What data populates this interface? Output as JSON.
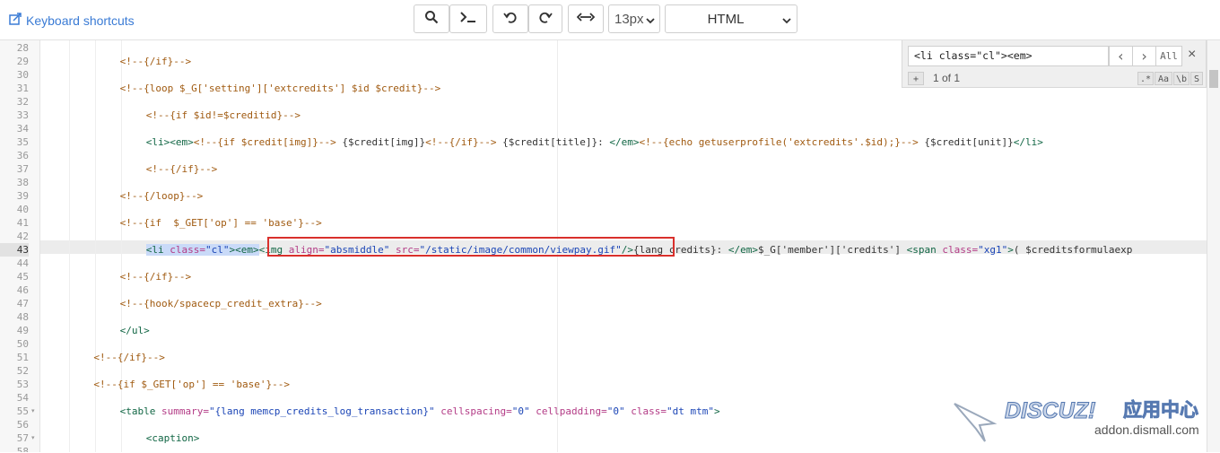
{
  "toolbar": {
    "keyboard_shortcuts": "Keyboard shortcuts",
    "font_size": "13px",
    "language": "HTML",
    "icons": [
      "search-icon",
      "terminal-icon",
      "undo-icon",
      "redo-icon",
      "wrap-toggle-icon"
    ]
  },
  "find": {
    "query": "<li class=\"cl\"><em>",
    "next_prev": [
      "‹",
      "›"
    ],
    "all_label": "All",
    "close_label": "×",
    "replace_toggle": "+",
    "count": "1 of 1",
    "options": [
      ".*",
      "Aa",
      "\\b",
      "S"
    ]
  },
  "colors": {
    "comment": "#a05a10",
    "tag": "#116644",
    "attribute": "#b33b86",
    "string": "#1b45b6",
    "highlight": "#c9daf8",
    "red_box": "#d9302c",
    "link": "#3a7bd5"
  },
  "editor": {
    "active_line": "43",
    "lines": [
      {
        "no": "28",
        "fold": "",
        "indent": 0,
        "tokens": []
      },
      {
        "no": "29",
        "fold": "",
        "indent": 3,
        "tokens": [
          {
            "c": "c",
            "t": "<!--{/if}-->"
          }
        ]
      },
      {
        "no": "30",
        "fold": "",
        "indent": 0,
        "tokens": []
      },
      {
        "no": "31",
        "fold": "",
        "indent": 3,
        "tokens": [
          {
            "c": "c",
            "t": "<!--{loop $_G['setting']['extcredits'] $id $credit}-->"
          }
        ]
      },
      {
        "no": "32",
        "fold": "",
        "indent": 0,
        "tokens": []
      },
      {
        "no": "33",
        "fold": "",
        "indent": 4,
        "tokens": [
          {
            "c": "c",
            "t": "<!--{if $id!=$creditid}-->"
          }
        ]
      },
      {
        "no": "34",
        "fold": "",
        "indent": 0,
        "tokens": []
      },
      {
        "no": "35",
        "fold": "",
        "indent": 4,
        "tokens": [
          {
            "c": "t",
            "t": "<li><em>"
          },
          {
            "c": "c",
            "t": "<!--{if $credit[img]}-->"
          },
          {
            "c": "p",
            "t": " {$credit[img]}"
          },
          {
            "c": "c",
            "t": "<!--{/if}-->"
          },
          {
            "c": "p",
            "t": " {$credit[title]}: "
          },
          {
            "c": "t",
            "t": "</em>"
          },
          {
            "c": "c",
            "t": "<!--{echo getuserprofile('extcredits'.$id);}-->"
          },
          {
            "c": "p",
            "t": " {$credit[unit]}"
          },
          {
            "c": "t",
            "t": "</li>"
          }
        ]
      },
      {
        "no": "36",
        "fold": "",
        "indent": 0,
        "tokens": []
      },
      {
        "no": "37",
        "fold": "",
        "indent": 4,
        "tokens": [
          {
            "c": "c",
            "t": "<!--{/if}-->"
          }
        ]
      },
      {
        "no": "38",
        "fold": "",
        "indent": 0,
        "tokens": []
      },
      {
        "no": "39",
        "fold": "",
        "indent": 3,
        "tokens": [
          {
            "c": "c",
            "t": "<!--{/loop}-->"
          }
        ]
      },
      {
        "no": "40",
        "fold": "",
        "indent": 0,
        "tokens": []
      },
      {
        "no": "41",
        "fold": "",
        "indent": 3,
        "tokens": [
          {
            "c": "c",
            "t": "<!--{if  $_GET['op'] == 'base'}-->"
          }
        ]
      },
      {
        "no": "42",
        "fold": "",
        "indent": 0,
        "tokens": []
      },
      {
        "no": "43",
        "fold": "",
        "indent": 4,
        "tokens": [
          {
            "c": "t",
            "t": "<li",
            "h": 1
          },
          {
            "c": "p",
            "t": " ",
            "h": 1
          },
          {
            "c": "a",
            "t": "class=",
            "h": 1
          },
          {
            "c": "s",
            "t": "\"cl\"",
            "h": 1
          },
          {
            "c": "t",
            "t": "><em>",
            "h": 1
          },
          {
            "c": "t",
            "t": "<img"
          },
          {
            "c": "p",
            "t": " "
          },
          {
            "c": "a",
            "t": "align="
          },
          {
            "c": "s",
            "t": "\"absmiddle\""
          },
          {
            "c": "p",
            "t": " "
          },
          {
            "c": "a",
            "t": "src="
          },
          {
            "c": "s",
            "t": "\"/static/image/common/viewpay.gif\""
          },
          {
            "c": "t",
            "t": "/>"
          },
          {
            "c": "p",
            "t": "{lang credits}: "
          },
          {
            "c": "t",
            "t": "</em>"
          },
          {
            "c": "p",
            "t": "$_G['member']['credits'] "
          },
          {
            "c": "t",
            "t": "<span"
          },
          {
            "c": "p",
            "t": " "
          },
          {
            "c": "a",
            "t": "class="
          },
          {
            "c": "s",
            "t": "\"xg1\""
          },
          {
            "c": "t",
            "t": ">"
          },
          {
            "c": "p",
            "t": "( $creditsformulaexp"
          }
        ]
      },
      {
        "no": "44",
        "fold": "",
        "indent": 0,
        "tokens": []
      },
      {
        "no": "45",
        "fold": "",
        "indent": 3,
        "tokens": [
          {
            "c": "c",
            "t": "<!--{/if}-->"
          }
        ]
      },
      {
        "no": "46",
        "fold": "",
        "indent": 0,
        "tokens": []
      },
      {
        "no": "47",
        "fold": "",
        "indent": 3,
        "tokens": [
          {
            "c": "c",
            "t": "<!--{hook/spacecp_credit_extra}-->"
          }
        ]
      },
      {
        "no": "48",
        "fold": "",
        "indent": 0,
        "tokens": []
      },
      {
        "no": "49",
        "fold": "",
        "indent": 3,
        "tokens": [
          {
            "c": "t",
            "t": "</ul>"
          }
        ]
      },
      {
        "no": "50",
        "fold": "",
        "indent": 0,
        "tokens": []
      },
      {
        "no": "51",
        "fold": "",
        "indent": 2,
        "tokens": [
          {
            "c": "c",
            "t": "<!--{/if}-->"
          }
        ]
      },
      {
        "no": "52",
        "fold": "",
        "indent": 0,
        "tokens": []
      },
      {
        "no": "53",
        "fold": "",
        "indent": 2,
        "tokens": [
          {
            "c": "c",
            "t": "<!--{if $_GET['op'] == 'base'}-->"
          }
        ]
      },
      {
        "no": "54",
        "fold": "",
        "indent": 0,
        "tokens": []
      },
      {
        "no": "55",
        "fold": "▾",
        "indent": 3,
        "tokens": [
          {
            "c": "t",
            "t": "<table"
          },
          {
            "c": "p",
            "t": " "
          },
          {
            "c": "a",
            "t": "summary="
          },
          {
            "c": "s",
            "t": "\"{lang memcp_credits_log_transaction}\""
          },
          {
            "c": "p",
            "t": " "
          },
          {
            "c": "a",
            "t": "cellspacing="
          },
          {
            "c": "s",
            "t": "\"0\""
          },
          {
            "c": "p",
            "t": " "
          },
          {
            "c": "a",
            "t": "cellpadding="
          },
          {
            "c": "s",
            "t": "\"0\""
          },
          {
            "c": "p",
            "t": " "
          },
          {
            "c": "a",
            "t": "class="
          },
          {
            "c": "s",
            "t": "\"dt mtm\""
          },
          {
            "c": "t",
            "t": ">"
          }
        ]
      },
      {
        "no": "56",
        "fold": "",
        "indent": 0,
        "tokens": []
      },
      {
        "no": "57",
        "fold": "▾",
        "indent": 4,
        "tokens": [
          {
            "c": "t",
            "t": "<caption>"
          }
        ]
      },
      {
        "no": "58",
        "fold": "",
        "indent": 0,
        "tokens": []
      }
    ]
  },
  "watermark": {
    "brand": "DISCUZ!",
    "cn": "应用中心",
    "site": "addon.dismall.com"
  }
}
